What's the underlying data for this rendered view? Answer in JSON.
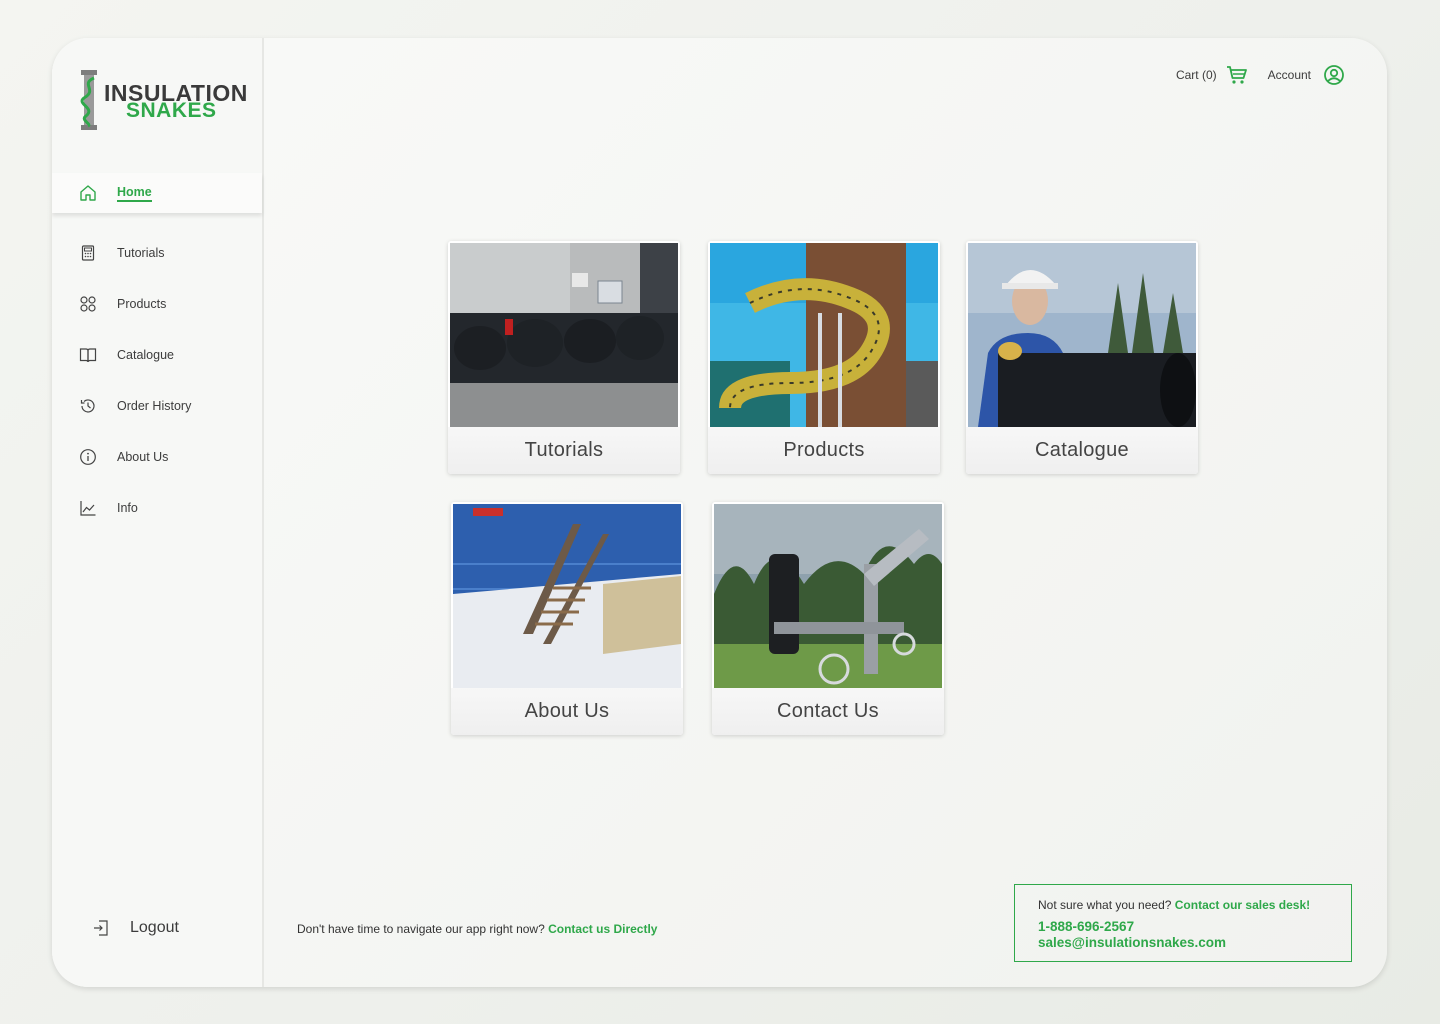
{
  "brand": {
    "line1": "INSULATION",
    "line2": "SNAKES",
    "accent": "#2fa84a"
  },
  "sidebar": {
    "items": [
      {
        "label": "Home",
        "icon": "home-icon",
        "active": true
      },
      {
        "label": "Tutorials",
        "icon": "calculator-icon"
      },
      {
        "label": "Products",
        "icon": "grid-circles-icon"
      },
      {
        "label": "Catalogue",
        "icon": "open-book-icon"
      },
      {
        "label": "Order History",
        "icon": "history-clock-icon"
      },
      {
        "label": "About Us",
        "icon": "info-circle-icon"
      },
      {
        "label": "Info",
        "icon": "line-chart-icon"
      }
    ],
    "logout_label": "Logout"
  },
  "header": {
    "cart_label": "Cart (0)",
    "account_label": "Account"
  },
  "tiles": [
    {
      "label": "Tutorials"
    },
    {
      "label": "Products"
    },
    {
      "label": "Catalogue"
    },
    {
      "label": "About Us"
    },
    {
      "label": "Contact Us"
    }
  ],
  "footer": {
    "prompt": "Don't have time to navigate our app right now? ",
    "link": "Contact us Directly"
  },
  "sales": {
    "question": "Not sure what you need? ",
    "link": "Contact our sales desk!",
    "phone": "1-888-696-2567",
    "email": "sales@insulationsnakes.com"
  }
}
